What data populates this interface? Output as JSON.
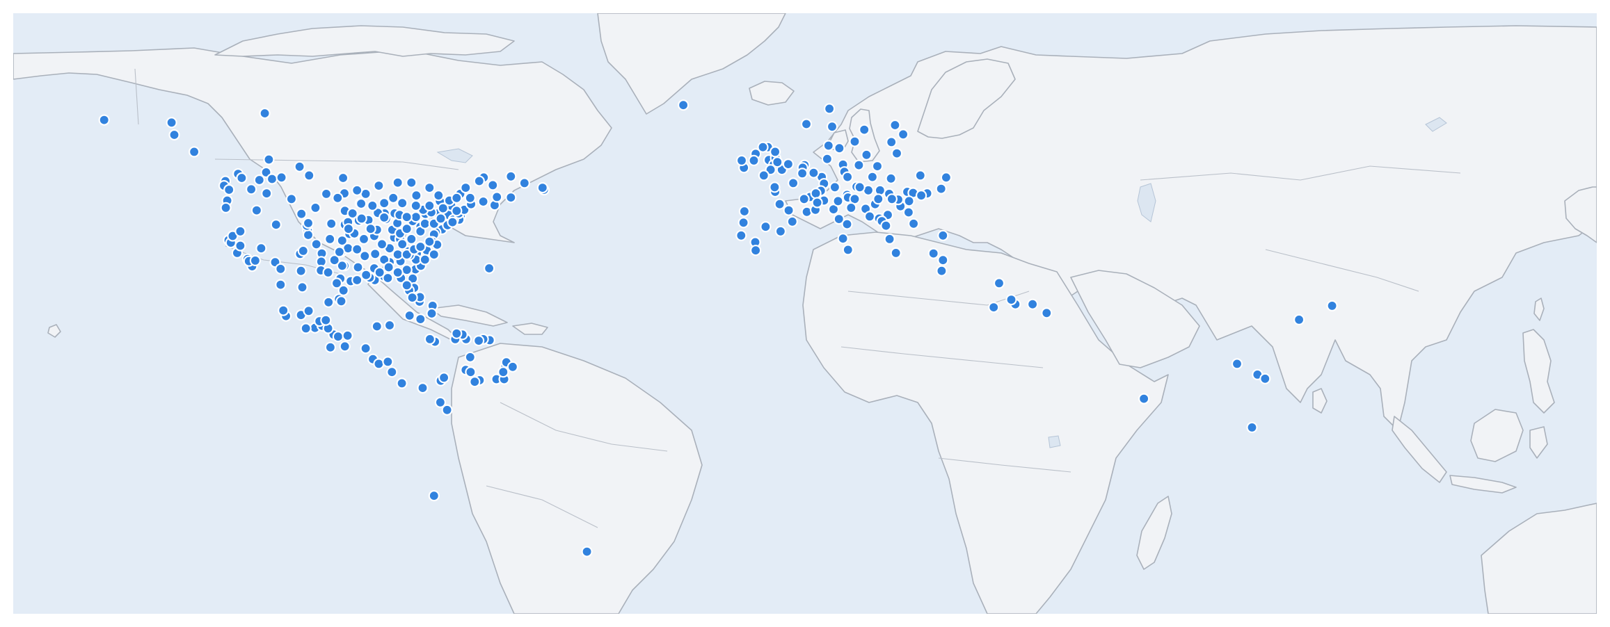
{
  "map": {
    "projection": "equirectangular",
    "lon_range": [
      -170,
      180
    ],
    "lat_range": [
      -35,
      82
    ],
    "colors": {
      "ocean": "#e3ecf6",
      "land": "#f1f3f6",
      "coast": "#a9b0ba",
      "marker": "#3182de",
      "marker_outline": "#ffffff"
    }
  },
  "locations": [
    [
      -149.9,
      61.2
    ],
    [
      -134.4,
      58.3
    ],
    [
      -130,
      55
    ],
    [
      -123.1,
      49.3
    ],
    [
      -123.4,
      48.4
    ],
    [
      -122.3,
      47.6
    ],
    [
      -122.7,
      45.5
    ],
    [
      -123,
      44.1
    ],
    [
      -122.4,
      37.8
    ],
    [
      -121.9,
      37.3
    ],
    [
      -121.5,
      38.6
    ],
    [
      -120.5,
      35.3
    ],
    [
      -118.2,
      34.1
    ],
    [
      -117.2,
      32.7
    ],
    [
      -117.9,
      33.7
    ],
    [
      -116.5,
      33.8
    ],
    [
      -119.8,
      36.7
    ],
    [
      -119.8,
      39.5
    ],
    [
      -115.2,
      36.2
    ],
    [
      -112.1,
      33.5
    ],
    [
      -110.9,
      32.2
    ],
    [
      -111.9,
      40.8
    ],
    [
      -116.2,
      43.6
    ],
    [
      -117.4,
      47.7
    ],
    [
      -114,
      46.9
    ],
    [
      -108.5,
      45.8
    ],
    [
      -106.6,
      35.1
    ],
    [
      -105.9,
      35.7
    ],
    [
      -104.9,
      39.7
    ],
    [
      -104.8,
      38.8
    ],
    [
      -105.1,
      40.6
    ],
    [
      -106.3,
      42.9
    ],
    [
      -104.8,
      41.1
    ],
    [
      -100.8,
      46.8
    ],
    [
      -96.8,
      46.9
    ],
    [
      -103.2,
      44.1
    ],
    [
      -96.7,
      43.5
    ],
    [
      -96.7,
      40.8
    ],
    [
      -96,
      41.3
    ],
    [
      -97.3,
      37.7
    ],
    [
      -95.7,
      39
    ],
    [
      -94.6,
      39.1
    ],
    [
      -97.5,
      35.5
    ],
    [
      -96,
      36.2
    ],
    [
      -97.7,
      30.3
    ],
    [
      -98.5,
      29.4
    ],
    [
      -95.4,
      29.8
    ],
    [
      -96.8,
      32.8
    ],
    [
      -97.3,
      32.8
    ],
    [
      -101.8,
      35.2
    ],
    [
      -101.9,
      33.6
    ],
    [
      -106.4,
      31.8
    ],
    [
      -93.3,
      45
    ],
    [
      -93.1,
      44.9
    ],
    [
      -92.1,
      46.8
    ],
    [
      -93.6,
      41.6
    ],
    [
      -91.5,
      41.7
    ],
    [
      -90.2,
      38.6
    ],
    [
      -92.3,
      34.7
    ],
    [
      -90.1,
      30
    ],
    [
      -91.2,
      30.5
    ],
    [
      -93.8,
      32.5
    ],
    [
      -90.2,
      32.3
    ],
    [
      -88,
      30.7
    ],
    [
      -86.8,
      33.5
    ],
    [
      -86.8,
      36.2
    ],
    [
      -90,
      35.1
    ],
    [
      -85.8,
      38.3
    ],
    [
      -84.5,
      38
    ],
    [
      -84.4,
      33.7
    ],
    [
      -81.1,
      32.1
    ],
    [
      -81.7,
      30.3
    ],
    [
      -81.4,
      28.5
    ],
    [
      -82.5,
      28
    ],
    [
      -80.2,
      25.8
    ],
    [
      -80.1,
      26.7
    ],
    [
      -81.8,
      26.6
    ],
    [
      -84.3,
      30.4
    ],
    [
      -87.2,
      30.4
    ],
    [
      -87.9,
      43
    ],
    [
      -89.4,
      43.1
    ],
    [
      -87.6,
      41.9
    ],
    [
      -88,
      42.2
    ],
    [
      -89.6,
      39.8
    ],
    [
      -86.2,
      39.8
    ],
    [
      -85.1,
      41.1
    ],
    [
      -84.5,
      39.1
    ],
    [
      -83,
      40
    ],
    [
      -81.7,
      41.5
    ],
    [
      -83,
      42.3
    ],
    [
      -85.7,
      43
    ],
    [
      -84.6,
      42.7
    ],
    [
      -80,
      40.4
    ],
    [
      -75.2,
      39.9
    ],
    [
      -76.6,
      39.3
    ],
    [
      -77,
      38.9
    ],
    [
      -77.4,
      37.5
    ],
    [
      -76.3,
      36.9
    ],
    [
      -78.6,
      35.8
    ],
    [
      -80.8,
      35.2
    ],
    [
      -79.9,
      32.8
    ],
    [
      -81,
      34
    ],
    [
      -82.4,
      34.9
    ],
    [
      -82.6,
      35.6
    ],
    [
      -74,
      40.7
    ],
    [
      -73.8,
      42.7
    ],
    [
      -76.1,
      43
    ],
    [
      -78.9,
      42.9
    ],
    [
      -77.6,
      43.2
    ],
    [
      -71.1,
      42.4
    ],
    [
      -71.4,
      41.8
    ],
    [
      -72.7,
      41.8
    ],
    [
      -72.9,
      41.3
    ],
    [
      -73.2,
      44.5
    ],
    [
      -71.5,
      43
    ],
    [
      -70.3,
      43.7
    ],
    [
      -68.8,
      44.8
    ],
    [
      -79.4,
      43.7
    ],
    [
      -75.7,
      45.4
    ],
    [
      -73.6,
      45.5
    ],
    [
      -71.2,
      46.8
    ],
    [
      -63.6,
      44.6
    ],
    [
      -66.1,
      45.3
    ],
    [
      -63.1,
      46.2
    ],
    [
      -60,
      46.1
    ],
    [
      -52.7,
      47.6
    ],
    [
      -57,
      48.9
    ],
    [
      -97.1,
      49.9
    ],
    [
      -104.6,
      50.4
    ],
    [
      -106.7,
      52.1
    ],
    [
      -113.5,
      53.5
    ],
    [
      -114.1,
      51
    ],
    [
      -120.3,
      50.7
    ],
    [
      -119.5,
      49.9
    ],
    [
      -115.6,
      49.5
    ],
    [
      -112.8,
      49.7
    ],
    [
      -110.7,
      50
    ],
    [
      -135,
      60.7
    ],
    [
      -114.4,
      62.5
    ],
    [
      -89.2,
      48.4
    ],
    [
      -80.9,
      46.5
    ],
    [
      -81,
      42.3
    ],
    [
      -83,
      42.3
    ],
    [
      -86,
      46
    ],
    [
      -94,
      47.5
    ],
    [
      -88,
      45
    ],
    [
      -90.6,
      44.5
    ],
    [
      -93,
      42
    ],
    [
      -91,
      40
    ],
    [
      -95.9,
      40
    ],
    [
      -95,
      43
    ],
    [
      -98.3,
      46
    ],
    [
      -99.7,
      41
    ],
    [
      -100,
      38
    ],
    [
      -103,
      37
    ],
    [
      -102,
      31.9
    ],
    [
      -100.4,
      31.5
    ],
    [
      -99,
      33.9
    ],
    [
      -97.9,
      35.5
    ],
    [
      -94,
      36
    ],
    [
      -92.5,
      38
    ],
    [
      -88.5,
      37
    ],
    [
      -88,
      34
    ],
    [
      -85,
      35
    ],
    [
      -84,
      37
    ],
    [
      -83,
      35
    ],
    [
      -81.4,
      36
    ],
    [
      -82,
      38
    ],
    [
      -80,
      39.5
    ],
    [
      -79,
      41
    ],
    [
      -77,
      41
    ],
    [
      -75.5,
      42
    ],
    [
      -75,
      44
    ],
    [
      -72,
      43.5
    ],
    [
      -69,
      46
    ],
    [
      -78,
      44.5
    ],
    [
      -81,
      44.5
    ],
    [
      -84,
      45
    ],
    [
      -82,
      49
    ],
    [
      -85,
      49
    ],
    [
      -78,
      48
    ],
    [
      -76,
      46.5
    ],
    [
      -72,
      46
    ],
    [
      -70,
      48
    ],
    [
      -66,
      50
    ],
    [
      -64,
      48.5
    ],
    [
      -67,
      49.3
    ],
    [
      -60,
      50.2
    ],
    [
      -53,
      48
    ],
    [
      -78,
      37.5
    ],
    [
      -80,
      36.5
    ],
    [
      -77,
      35
    ],
    [
      -79,
      34
    ],
    [
      -83,
      32
    ],
    [
      -85,
      31.5
    ],
    [
      -83,
      29
    ],
    [
      -87,
      32.5
    ],
    [
      -89,
      31.5
    ],
    [
      -92,
      31
    ],
    [
      -94,
      30
    ],
    [
      -97,
      28
    ],
    [
      -98,
      26.3
    ],
    [
      -100.3,
      25.7
    ],
    [
      -99.2,
      19.4
    ],
    [
      -103.3,
      20.7
    ],
    [
      -98.2,
      19
    ],
    [
      -96.1,
      19.2
    ],
    [
      -89.6,
      21
    ],
    [
      -86.8,
      21.2
    ],
    [
      -105.3,
      20.6
    ],
    [
      -109.7,
      23
    ],
    [
      -110.3,
      24.1
    ],
    [
      -106.4,
      23.2
    ],
    [
      -106.1,
      28.6
    ],
    [
      -110.9,
      29.1
    ],
    [
      -104.7,
      24
    ],
    [
      -101.7,
      21.1
    ],
    [
      -100.4,
      20.6
    ],
    [
      -102.3,
      22
    ],
    [
      -100.9,
      22.2
    ],
    [
      -97.5,
      25.9
    ],
    [
      -96.7,
      17.1
    ],
    [
      -99.9,
      16.9
    ],
    [
      -92.1,
      16.7
    ],
    [
      -90.5,
      14.6
    ],
    [
      -89.2,
      13.7
    ],
    [
      -87.2,
      14.1
    ],
    [
      -86.3,
      12.1
    ],
    [
      -84.1,
      9.9
    ],
    [
      -79.5,
      9
    ],
    [
      -75.5,
      10.4
    ],
    [
      -74.8,
      11
    ],
    [
      -74.1,
      4.7
    ],
    [
      -75.6,
      6.2
    ],
    [
      -66.9,
      10.5
    ],
    [
      -68,
      10.2
    ],
    [
      -63.2,
      10.7
    ],
    [
      -61.5,
      10.7
    ],
    [
      -61.2,
      13.2
    ],
    [
      -61,
      14
    ],
    [
      -61.7,
      12.1
    ],
    [
      -59.6,
      13.1
    ],
    [
      -64.7,
      18.3
    ],
    [
      -66.1,
      18.5
    ],
    [
      -67.1,
      18.2
    ],
    [
      -69.9,
      18.5
    ],
    [
      -70.7,
      19.4
    ],
    [
      -72.3,
      18.5
    ],
    [
      -76.8,
      18
    ],
    [
      -77.9,
      18.5
    ],
    [
      -80,
      22.4
    ],
    [
      -82.4,
      23.1
    ],
    [
      -77.3,
      25
    ],
    [
      -77.5,
      23.5
    ],
    [
      -64.8,
      32.3
    ],
    [
      -77,
      -12
    ],
    [
      -43.2,
      -22.9
    ],
    [
      -70,
      12.5
    ],
    [
      -68.9,
      12.1
    ],
    [
      -69,
      15
    ],
    [
      -72,
      19.6
    ],
    [
      -21.9,
      64.1
    ],
    [
      18.1,
      59.3
    ],
    [
      11,
      59.9
    ],
    [
      10.4,
      63.4
    ],
    [
      5.3,
      60.4
    ],
    [
      24.9,
      60.2
    ],
    [
      25.3,
      54.7
    ],
    [
      24.1,
      56.9
    ],
    [
      26.7,
      58.4
    ],
    [
      16,
      57
    ],
    [
      12.6,
      55.7
    ],
    [
      10.2,
      56.2
    ],
    [
      9.9,
      53.6
    ],
    [
      8.7,
      50.1
    ],
    [
      13.4,
      52.5
    ],
    [
      11.6,
      48.1
    ],
    [
      6.9,
      50.9
    ],
    [
      9.2,
      48.8
    ],
    [
      13.7,
      51.1
    ],
    [
      8.5,
      47.4
    ],
    [
      6.1,
      46.2
    ],
    [
      7.4,
      46.9
    ],
    [
      4.9,
      52.4
    ],
    [
      4.5,
      51.9
    ],
    [
      4.4,
      50.8
    ],
    [
      2.4,
      48.9
    ],
    [
      5.4,
      43.3
    ],
    [
      4.8,
      45.8
    ],
    [
      7.3,
      43.7
    ],
    [
      1.4,
      43.6
    ],
    [
      -0.6,
      44.8
    ],
    [
      -1.6,
      47.2
    ],
    [
      -1.7,
      48.1
    ],
    [
      2.2,
      41.4
    ],
    [
      -3.7,
      40.4
    ],
    [
      -0.4,
      39.5
    ],
    [
      -6,
      37.4
    ],
    [
      -9.1,
      38.7
    ],
    [
      -8.6,
      41.2
    ],
    [
      -8.4,
      43.4
    ],
    [
      -5.9,
      35.8
    ],
    [
      -0.1,
      51.5
    ],
    [
      -2.2,
      53.5
    ],
    [
      -3,
      53.4
    ],
    [
      -1.9,
      52.5
    ],
    [
      -1.5,
      53.8
    ],
    [
      -2.6,
      51.5
    ],
    [
      -3.2,
      55.9
    ],
    [
      -4.3,
      55.9
    ],
    [
      -5.9,
      54.6
    ],
    [
      -6.3,
      53.3
    ],
    [
      -8.5,
      51.9
    ],
    [
      -9,
      53.3
    ],
    [
      -1.6,
      55
    ],
    [
      -1.1,
      53
    ],
    [
      1.3,
      52.6
    ],
    [
      -4.1,
      50.4
    ],
    [
      12.5,
      41.9
    ],
    [
      9.2,
      45.5
    ],
    [
      11.3,
      43.8
    ],
    [
      14.3,
      40.9
    ],
    [
      12.3,
      45.4
    ],
    [
      7.7,
      45.1
    ],
    [
      13.4,
      38.1
    ],
    [
      16.4,
      48.2
    ],
    [
      14.3,
      46.6
    ],
    [
      14.5,
      46.1
    ],
    [
      16,
      45.8
    ],
    [
      19,
      47.5
    ],
    [
      21.6,
      47.5
    ],
    [
      14.4,
      50.1
    ],
    [
      17.1,
      48.1
    ],
    [
      21,
      52.2
    ],
    [
      19.9,
      50.1
    ],
    [
      16.9,
      52.4
    ],
    [
      18.6,
      54.4
    ],
    [
      26.1,
      44.4
    ],
    [
      23.3,
      42.7
    ],
    [
      20.5,
      44.8
    ],
    [
      18.4,
      43.9
    ],
    [
      15.2,
      44.1
    ],
    [
      19.3,
      42.4
    ],
    [
      21.4,
      42
    ],
    [
      27.6,
      47.2
    ],
    [
      30.5,
      50.4
    ],
    [
      36.2,
      50
    ],
    [
      28.9,
      47
    ],
    [
      24,
      49.8
    ],
    [
      32,
      46.9
    ],
    [
      30.7,
      46.5
    ],
    [
      35.1,
      47.8
    ],
    [
      23.6,
      46.8
    ],
    [
      21.2,
      45.8
    ],
    [
      28,
      45.4
    ],
    [
      25.6,
      45.7
    ],
    [
      24.2,
      45.8
    ],
    [
      27.9,
      43.2
    ],
    [
      22,
      41.5
    ],
    [
      29,
      41
    ],
    [
      35.5,
      38.7
    ],
    [
      23.7,
      38
    ],
    [
      22.9,
      40.6
    ],
    [
      25.1,
      35.3
    ],
    [
      14.5,
      35.9
    ],
    [
      33.4,
      35.2
    ],
    [
      35.2,
      31.8
    ],
    [
      35.5,
      33.9
    ],
    [
      47.9,
      29.4
    ],
    [
      46.7,
      24.7
    ],
    [
      51.5,
      25.3
    ],
    [
      55.3,
      25.3
    ],
    [
      58.4,
      23.6
    ],
    [
      50.6,
      26.2
    ],
    [
      79.9,
      6.9
    ],
    [
      100.5,
      13.7
    ],
    [
      105,
      11.6
    ],
    [
      106.7,
      10.8
    ],
    [
      103.8,
      1.3
    ],
    [
      114.2,
      22.3
    ],
    [
      121.5,
      25
    ]
  ]
}
